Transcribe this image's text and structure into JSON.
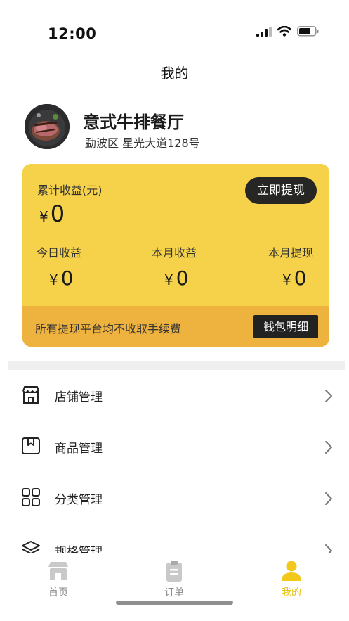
{
  "status": {
    "time": "12:00"
  },
  "nav": {
    "title": "我的"
  },
  "profile": {
    "avatar_icon": "steak-photo",
    "shop_name": "意式牛排餐厅",
    "address": "勐波区 星光大道128号"
  },
  "earnings": {
    "total_label": "累计收益(元)",
    "currency": "¥",
    "total_value": "0",
    "withdraw_label": "立即提现",
    "stats": [
      {
        "label": "今日收益",
        "value": "0"
      },
      {
        "label": "本月收益",
        "value": "0"
      },
      {
        "label": "本月提现",
        "value": "0"
      }
    ],
    "fee_note": "所有提现平台均不收取手续费",
    "wallet_label": "钱包明细"
  },
  "menu": [
    {
      "label": "店铺管理",
      "icon": "store-icon"
    },
    {
      "label": "商品管理",
      "icon": "box-icon"
    },
    {
      "label": "分类管理",
      "icon": "grid-icon"
    },
    {
      "label": "规格管理",
      "icon": "layers-icon"
    }
  ],
  "tabs": [
    {
      "label": "首页",
      "icon": "store-icon",
      "active": false
    },
    {
      "label": "订单",
      "icon": "clipboard-icon",
      "active": false
    },
    {
      "label": "我的",
      "icon": "user-icon",
      "active": true
    }
  ],
  "colors": {
    "accent": "#f5d24a",
    "footer": "#eeb23e",
    "tab_active": "#e9c416",
    "dark": "#262624"
  }
}
